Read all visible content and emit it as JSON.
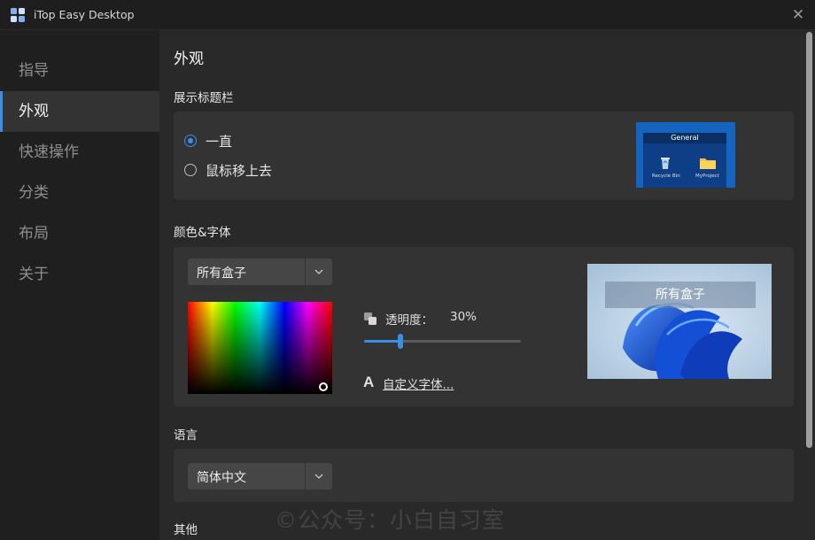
{
  "window": {
    "title": "iTop Easy Desktop",
    "close_icon": "close-icon"
  },
  "sidebar": {
    "items": [
      {
        "label": "指导",
        "active": false
      },
      {
        "label": "外观",
        "active": true
      },
      {
        "label": "快速操作",
        "active": false
      },
      {
        "label": "分类",
        "active": false
      },
      {
        "label": "布局",
        "active": false
      },
      {
        "label": "关于",
        "active": false
      }
    ]
  },
  "main": {
    "title": "外观",
    "titlebar_section": {
      "label": "展示标题栏",
      "options": [
        {
          "label": "一直",
          "selected": true
        },
        {
          "label": "鼠标移上去",
          "selected": false
        }
      ],
      "preview": {
        "header": "General",
        "icons": [
          "Recycle Bin",
          "MyProject"
        ]
      }
    },
    "color_section": {
      "label": "颜色&字体",
      "box_select": {
        "value": "所有盒子"
      },
      "opacity": {
        "label": "透明度：",
        "value": "30%",
        "fraction": 0.3
      },
      "custom_font": "自定义字体...",
      "preview_title": "所有盒子"
    },
    "language_section": {
      "label": "语言",
      "select": {
        "value": "简体中文"
      }
    },
    "other_section": {
      "label": "其他"
    }
  },
  "watermark": "©公众号：小白自习室",
  "colors": {
    "accent": "#3a8ee6",
    "background": "#292929",
    "card": "#333333",
    "sidebar_active": "#333333"
  }
}
